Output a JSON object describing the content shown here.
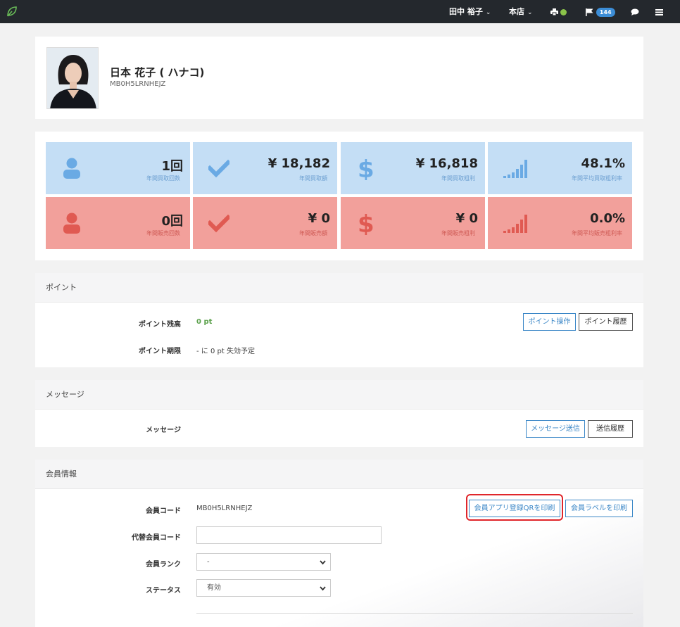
{
  "topbar": {
    "user_name": "田中 裕子",
    "store": "本店",
    "notification_count": "144"
  },
  "profile": {
    "name": "日本 花子 ( ハナコ)",
    "code": "MB0H5LRNHEJZ"
  },
  "stats": {
    "buy": [
      {
        "value": "1回",
        "label": "年間買取回数",
        "icon": "user-icon"
      },
      {
        "value": "¥ 18,182",
        "label": "年間買取額",
        "icon": "check-icon"
      },
      {
        "value": "¥ 16,818",
        "label": "年間買取粗利",
        "icon": "dollar-icon"
      },
      {
        "value": "48.1%",
        "label": "年間平均買取粗利率",
        "icon": "signal-icon"
      }
    ],
    "sell": [
      {
        "value": "0回",
        "label": "年間販売回数",
        "icon": "user-icon"
      },
      {
        "value": "¥ 0",
        "label": "年間販売額",
        "icon": "check-icon"
      },
      {
        "value": "¥ 0",
        "label": "年間販売粗利",
        "icon": "dollar-icon"
      },
      {
        "value": "0.0%",
        "label": "年間平均販売粗利率",
        "icon": "signal-icon"
      }
    ],
    "colors": {
      "blue_tile": "#c4def5",
      "red_tile": "#f2a09b",
      "blue_icon": "#6aaae4",
      "red_icon": "#e05a52"
    }
  },
  "points": {
    "title": "ポイント",
    "balance_label": "ポイント残高",
    "balance_value": "0 pt",
    "expiry_label": "ポイント期限",
    "expiry_value": "- に 0 pt 失効予定",
    "operate_button": "ポイント操作",
    "history_button": "ポイント履歴"
  },
  "message": {
    "title": "メッセージ",
    "label": "メッセージ",
    "send_button": "メッセージ送信",
    "history_button": "送信履歴"
  },
  "member": {
    "title": "会員情報",
    "code_label": "会員コード",
    "code_value": "MB0H5LRNHEJZ",
    "alt_code_label": "代替会員コード",
    "alt_code_value": "",
    "rank_label": "会員ランク",
    "rank_value": "-",
    "status_label": "ステータス",
    "status_value": "有効",
    "print_qr_button": "会員アプリ登録QRを印刷",
    "print_label_button": "会員ラベルを印刷"
  }
}
